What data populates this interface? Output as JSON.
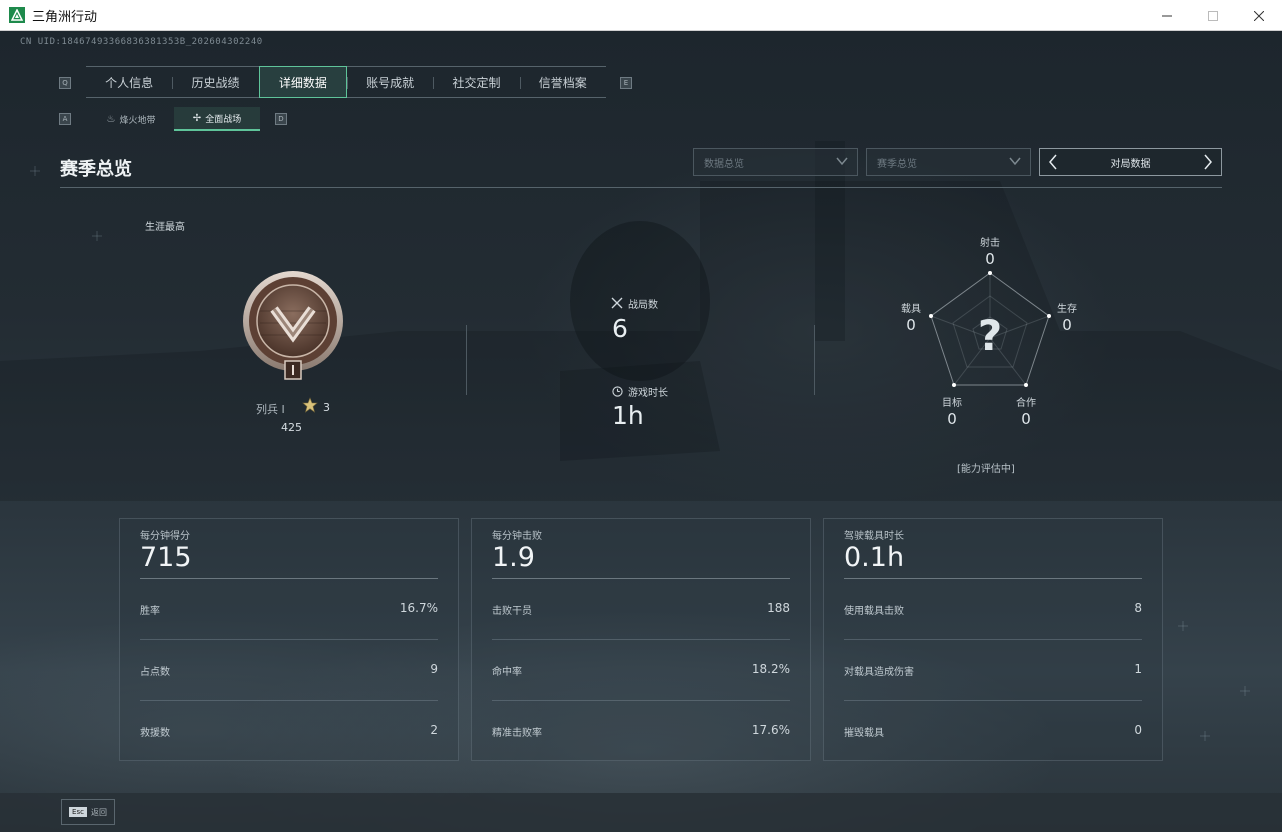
{
  "window": {
    "title": "三角洲行动"
  },
  "uid": "CN UID:18467493366836381353B_202604302240",
  "tabs": {
    "key_left": "Q",
    "key_right": "E",
    "items": [
      {
        "label": "个人信息"
      },
      {
        "label": "历史战绩"
      },
      {
        "label": "详细数据",
        "active": true
      },
      {
        "label": "账号成就"
      },
      {
        "label": "社交定制"
      },
      {
        "label": "信誉档案"
      }
    ]
  },
  "subtabs": {
    "key_left": "A",
    "key_right": "D",
    "items": [
      {
        "label": "烽火地带",
        "icon": "flame-icon"
      },
      {
        "label": "全面战场",
        "icon": "battle-icon",
        "active": true
      }
    ]
  },
  "section": {
    "title": "赛季总览",
    "dropdown_data": "数据总览",
    "dropdown_season": "赛季总览",
    "pager_label": "对局数据"
  },
  "rank": {
    "career_label": "生涯最高",
    "name": "列兵 I",
    "stars": "3",
    "points": "425"
  },
  "summary": {
    "battles_label": "战局数",
    "battles_value": "6",
    "time_label": "游戏时长",
    "time_value": "1h"
  },
  "radar": {
    "center_glyph": "?",
    "axes": [
      {
        "label": "射击",
        "value": "0"
      },
      {
        "label": "生存",
        "value": "0"
      },
      {
        "label": "合作",
        "value": "0"
      },
      {
        "label": "目标",
        "value": "0"
      },
      {
        "label": "载具",
        "value": "0"
      }
    ],
    "status": "[能力评估中]"
  },
  "cards": [
    {
      "title": "每分钟得分",
      "value": "715",
      "rows": [
        {
          "label": "胜率",
          "value": "16.7%"
        },
        {
          "label": "占点数",
          "value": "9"
        },
        {
          "label": "救援数",
          "value": "2"
        }
      ]
    },
    {
      "title": "每分钟击败",
      "value": "1.9",
      "rows": [
        {
          "label": "击败干员",
          "value": "188"
        },
        {
          "label": "命中率",
          "value": "18.2%"
        },
        {
          "label": "精准击败率",
          "value": "17.6%"
        }
      ]
    },
    {
      "title": "驾驶载具时长",
      "value": "0.1h",
      "rows": [
        {
          "label": "使用载具击败",
          "value": "8"
        },
        {
          "label": "对载具造成伤害",
          "value": "1"
        },
        {
          "label": "摧毁载具",
          "value": "0"
        }
      ]
    }
  ],
  "footer": {
    "esc_key": "Esc",
    "back_label": "返回"
  },
  "colors": {
    "accent": "#5fc49a",
    "background": "#1a2229"
  }
}
